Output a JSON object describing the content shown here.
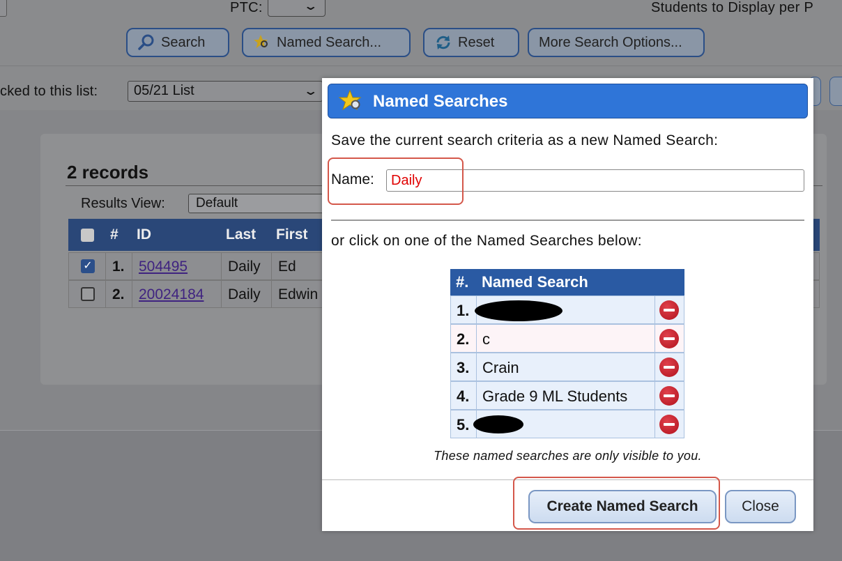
{
  "header": {
    "ptc_label": "PTC:",
    "students_label": "Students to Display per P",
    "buttons": {
      "search": "Search",
      "named_search": "Named Search...",
      "reset": "Reset",
      "more_options": "More Search Options..."
    },
    "locked_label": "cked to this list:",
    "list_value": "05/21 List"
  },
  "results": {
    "count_label": "2 records",
    "view_label": "Results View:",
    "view_value": "Default",
    "columns": [
      "#",
      "ID",
      "Last",
      "First"
    ],
    "rows": [
      {
        "checked": true,
        "num": "1.",
        "id": "504495",
        "last": "Daily",
        "first": "Ed"
      },
      {
        "checked": false,
        "num": "2.",
        "id": "20024184",
        "last": "Daily",
        "first": "Edwin"
      }
    ]
  },
  "dialog": {
    "title": "Named Searches",
    "save_prompt": "Save the current search criteria as a new Named Search:",
    "name_label": "Name:",
    "name_value": "Daily",
    "or_prompt": "or click on one of the Named Searches below:",
    "table_header_num": "#.",
    "table_header_name": "Named Search",
    "searches": [
      {
        "num": "1.",
        "name": "",
        "redacted": true
      },
      {
        "num": "2.",
        "name": "c",
        "redacted": false
      },
      {
        "num": "3.",
        "name": "Crain",
        "redacted": false
      },
      {
        "num": "4.",
        "name": "Grade 9 ML Students",
        "redacted": false
      },
      {
        "num": "5.",
        "name": "",
        "redacted": true
      }
    ],
    "note": "These named searches are only visible to you.",
    "create_button": "Create Named Search",
    "close_button": "Close"
  },
  "colors": {
    "dialog_title_bg": "#2f75d8",
    "highlight_border": "#d4574a",
    "name_text": "#e00000",
    "delete_icon": "#c01a25"
  }
}
